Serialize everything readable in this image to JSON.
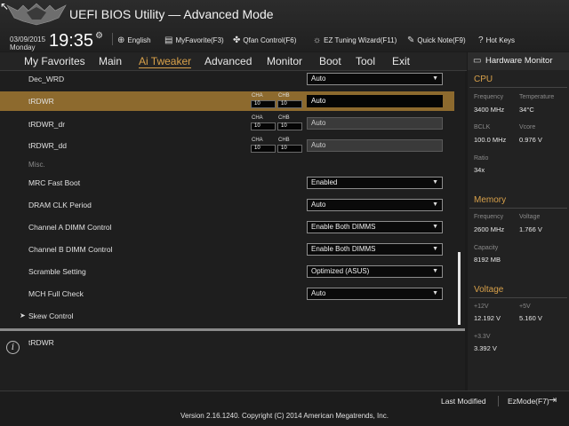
{
  "header": {
    "title": "UEFI BIOS Utility — Advanced Mode",
    "date": "03/09/2015",
    "day": "Monday",
    "time": "19:35",
    "buttons": {
      "language": "English",
      "myfavorite": "MyFavorite(F3)",
      "qfan": "Qfan Control(F6)",
      "ez_tuning": "EZ Tuning Wizard(F11)",
      "quick_note": "Quick Note(F9)",
      "hot_keys": "Hot Keys"
    }
  },
  "nav": {
    "tabs": [
      "My Favorites",
      "Main",
      "Ai Tweaker",
      "Advanced",
      "Monitor",
      "Boot",
      "Tool",
      "Exit"
    ],
    "active": "Ai Tweaker"
  },
  "settings": {
    "dec_wrd": {
      "label": "Dec_WRD",
      "value": "Auto"
    },
    "trdwr": {
      "label": "tRDWR",
      "cha": "CHA",
      "chb": "CHB",
      "cha_val": "10",
      "chb_val": "10",
      "value": "Auto"
    },
    "trdwr_dr": {
      "label": "tRDWR_dr",
      "cha": "CHA",
      "chb": "CHB",
      "cha_val": "10",
      "chb_val": "10",
      "value": "Auto"
    },
    "trdwr_dd": {
      "label": "tRDWR_dd",
      "cha": "CHA",
      "chb": "CHB",
      "cha_val": "10",
      "chb_val": "10",
      "value": "Auto"
    },
    "misc": "Misc.",
    "mrc_fast_boot": {
      "label": "MRC Fast Boot",
      "value": "Enabled"
    },
    "dram_clk_period": {
      "label": "DRAM CLK Period",
      "value": "Auto"
    },
    "channel_a": {
      "label": "Channel A DIMM Control",
      "value": "Enable Both DIMMS"
    },
    "channel_b": {
      "label": "Channel B DIMM Control",
      "value": "Enable Both DIMMS"
    },
    "scramble": {
      "label": "Scramble Setting",
      "value": "Optimized (ASUS)"
    },
    "mch_full_check": {
      "label": "MCH Full Check",
      "value": "Auto"
    },
    "skew_control": "Skew Control"
  },
  "info": {
    "text": "tRDWR"
  },
  "hw_monitor": {
    "title": "Hardware Monitor",
    "cpu": {
      "heading": "CPU",
      "frequency_label": "Frequency",
      "frequency": "3400 MHz",
      "temperature_label": "Temperature",
      "temperature": "34°C",
      "bclk_label": "BCLK",
      "bclk": "100.0 MHz",
      "vcore_label": "Vcore",
      "vcore": "0.976 V",
      "ratio_label": "Ratio",
      "ratio": "34x"
    },
    "memory": {
      "heading": "Memory",
      "frequency_label": "Frequency",
      "frequency": "2600 MHz",
      "voltage_label": "Voltage",
      "voltage": "1.766 V",
      "capacity_label": "Capacity",
      "capacity": "8192 MB"
    },
    "voltage": {
      "heading": "Voltage",
      "v12_label": "+12V",
      "v12": "12.192 V",
      "v5_label": "+5V",
      "v5": "5.160 V",
      "v33_label": "+3.3V",
      "v33": "3.392 V"
    }
  },
  "footer": {
    "last_modified": "Last Modified",
    "ezmode": "EzMode(F7)",
    "version": "Version 2.16.1240. Copyright (C) 2014 American Megatrends, Inc."
  },
  "colors": {
    "accent": "#d7a04a",
    "highlight": "#8d6a2e"
  }
}
